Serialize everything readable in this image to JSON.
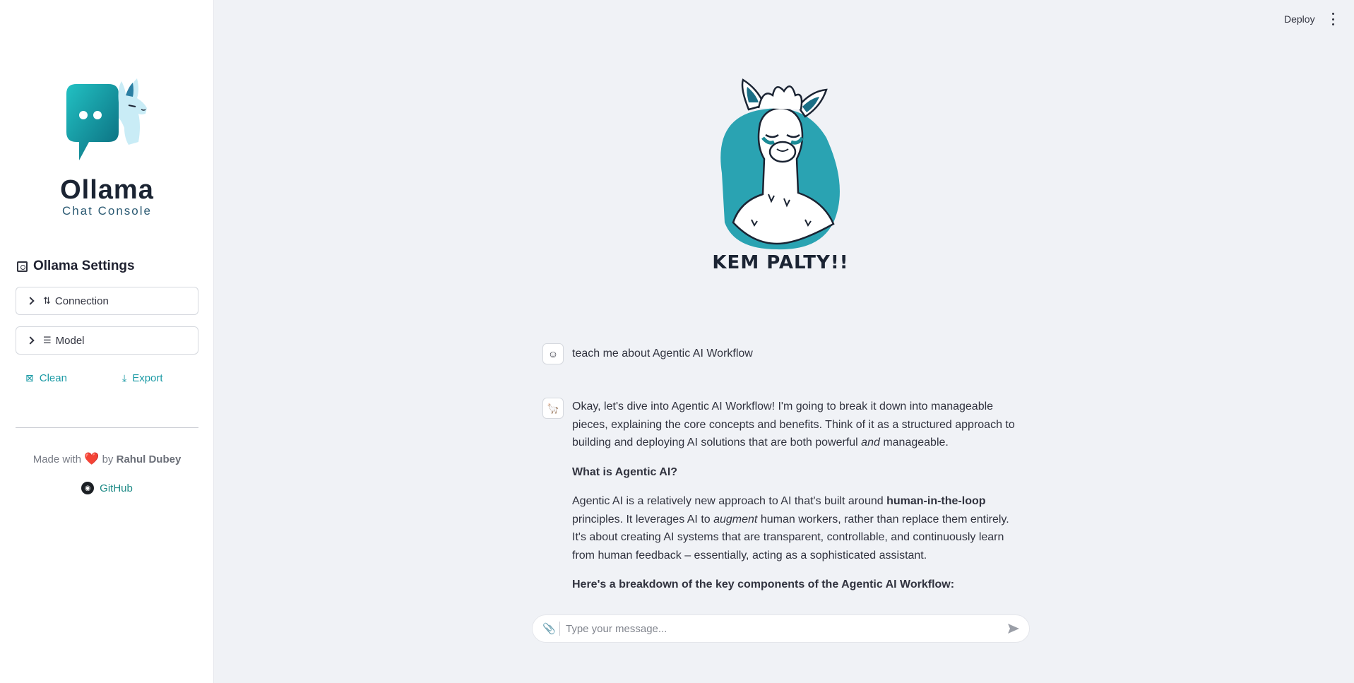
{
  "sidebar": {
    "logo_title": "Ollama",
    "logo_subtitle": "Chat Console",
    "settings_title": "Ollama Settings",
    "connection_label": "Connection",
    "model_label": "Model",
    "clean_label": "Clean",
    "export_label": "Export",
    "footer_made_with": "Made with",
    "footer_heart": "❤️",
    "footer_by": "by",
    "footer_author": "Rahul Dubey",
    "github_label": "GitHub"
  },
  "header": {
    "deploy_label": "Deploy"
  },
  "hero": {
    "caption": "KEM PALTY!!"
  },
  "chat": {
    "user_message": "teach me about Agentic AI Workflow",
    "bot_p1_a": "Okay, let's dive into Agentic AI Workflow! I'm going to break it down into manageable pieces, explaining the core concepts and benefits. Think of it as a structured approach to building and deploying AI solutions that are both powerful ",
    "bot_p1_em": "and",
    "bot_p1_b": " manageable.",
    "bot_h1": "What is Agentic AI?",
    "bot_p2_a": "Agentic AI is a relatively new approach to AI that's built around ",
    "bot_p2_strong": "human-in-the-loop",
    "bot_p2_b": " principles. It leverages AI to ",
    "bot_p2_em": "augment",
    "bot_p2_c": " human workers, rather than replace them entirely. It's about creating AI systems that are transparent, controllable, and continuously learn from human feedback – essentially, acting as a sophisticated assistant.",
    "bot_h2": "Here's a breakdown of the key components of the Agentic AI Workflow:"
  },
  "input": {
    "placeholder": "Type your message..."
  },
  "colors": {
    "accent": "#1b9aa5",
    "teal_dark": "#0c6b7a",
    "sidebar_bg": "#ffffff",
    "main_bg": "#f0f2f6"
  }
}
